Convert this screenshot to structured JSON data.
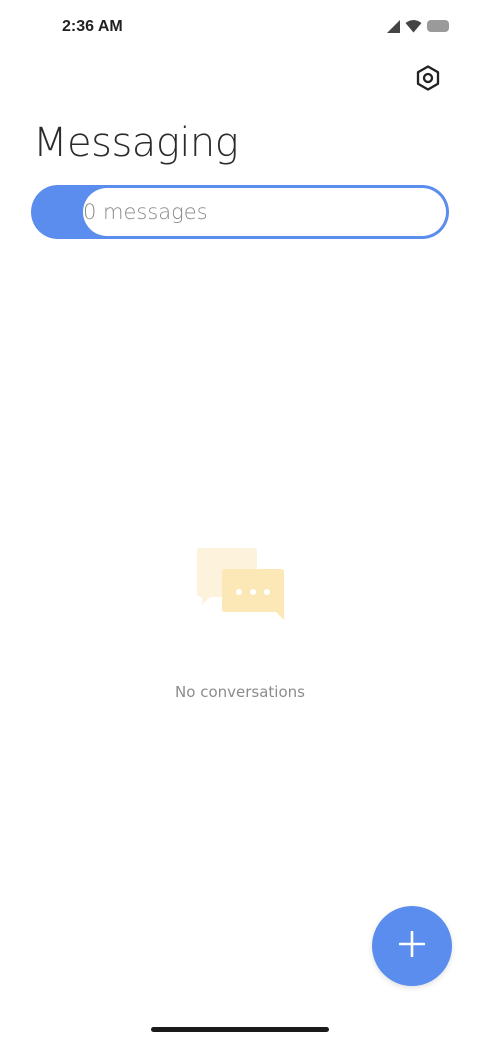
{
  "status_bar": {
    "time": "2:36 AM",
    "icons": [
      "cellular-signal-icon",
      "wifi-icon",
      "battery-icon"
    ]
  },
  "header": {
    "settings_icon": "gear-icon",
    "title": "Messaging"
  },
  "message_count": {
    "label": "0 messages"
  },
  "empty_state": {
    "illustration": "chat-bubbles-icon",
    "text": "No conversations"
  },
  "fab": {
    "icon": "plus-icon"
  },
  "colors": {
    "accent": "#5b8def",
    "bubble_back": "#fdf3dc",
    "bubble_front": "#fce8b6",
    "text_primary": "#2b2b2b",
    "text_secondary": "#8c8c8c"
  }
}
